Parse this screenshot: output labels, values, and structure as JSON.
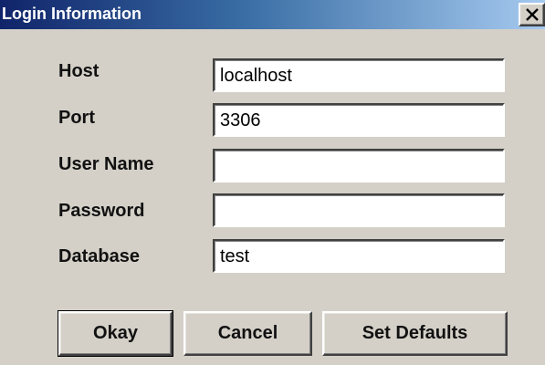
{
  "window": {
    "title": "Login Information"
  },
  "form": {
    "host_label": "Host",
    "host_value": "localhost",
    "port_label": "Port",
    "port_value": "3306",
    "username_label": "User Name",
    "username_value": "",
    "password_label": "Password",
    "password_value": "",
    "database_label": "Database",
    "database_value": "test"
  },
  "buttons": {
    "okay": "Okay",
    "cancel": "Cancel",
    "defaults": "Set Defaults"
  },
  "icons": {
    "close": "close-icon"
  },
  "colors": {
    "titlebar_start": "#10246a",
    "titlebar_end": "#a6caf0",
    "window_bg": "#d4d0c8"
  }
}
